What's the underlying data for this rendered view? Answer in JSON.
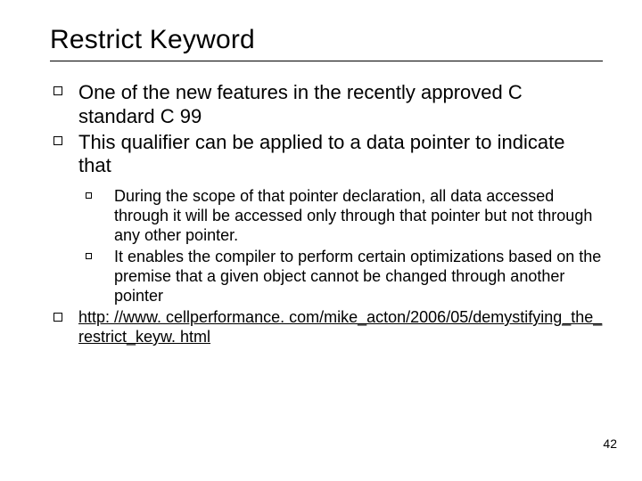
{
  "title": "Restrict Keyword",
  "bullets": [
    "One of the new features in the recently approved C standard C 99",
    "This qualifier can be applied to a data pointer to indicate that"
  ],
  "subbullets": [
    "During the scope of that pointer declaration, all data accessed through it will be accessed only through that pointer but not through any other pointer.",
    "It enables the compiler to perform certain optimizations based on the premise that a given object cannot be changed through another pointer"
  ],
  "link_text": "http: //www. cellperformance. com/mike_acton/2006/05/demystifying_the_restrict_keyw. html",
  "page_number": "42"
}
